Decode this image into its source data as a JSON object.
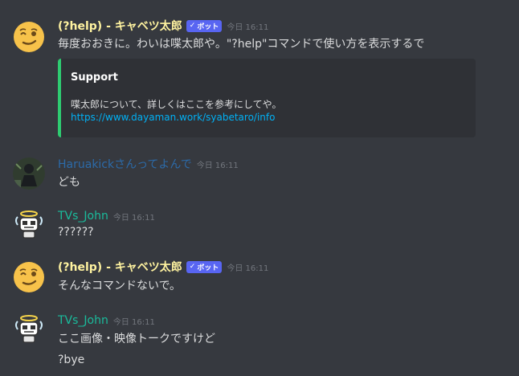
{
  "messages": [
    {
      "author": "(?help) - キャベツ太郎",
      "author_color": "#fff3a0",
      "bot": true,
      "bot_label": "ボット",
      "timestamp": "今日 16:11",
      "text": "毎度おおきに。わいは喋太郎や。\"?help\"コマンドで使い方を表示するで",
      "embed": {
        "title": "Support",
        "description": "喋太郎について、詳しくはここを参考にしてや。",
        "link": "https://www.dayaman.work/syabetaro/info",
        "accent": "#2ecc71"
      },
      "avatar_icon": "winking-face-icon"
    },
    {
      "author": "Haruakickさんってよんで",
      "author_color": "#2c6aa8",
      "timestamp": "今日 16:11",
      "text": "ども",
      "avatar_icon": "user-avatar-photo"
    },
    {
      "author": "TVs_John",
      "author_color": "#1abc9c",
      "timestamp": "今日 16:11",
      "text": "??????",
      "avatar_icon": "angel-robot-avatar"
    },
    {
      "author": "(?help) - キャベツ太郎",
      "author_color": "#fff3a0",
      "bot": true,
      "bot_label": "ボット",
      "timestamp": "今日 16:11",
      "text": "そんなコマンドないで。",
      "avatar_icon": "winking-face-icon"
    },
    {
      "author": "TVs_John",
      "author_color": "#1abc9c",
      "timestamp": "今日 16:11",
      "text": "ここ画像・映像トークですけど",
      "text2": "?bye",
      "avatar_icon": "angel-robot-avatar"
    }
  ]
}
